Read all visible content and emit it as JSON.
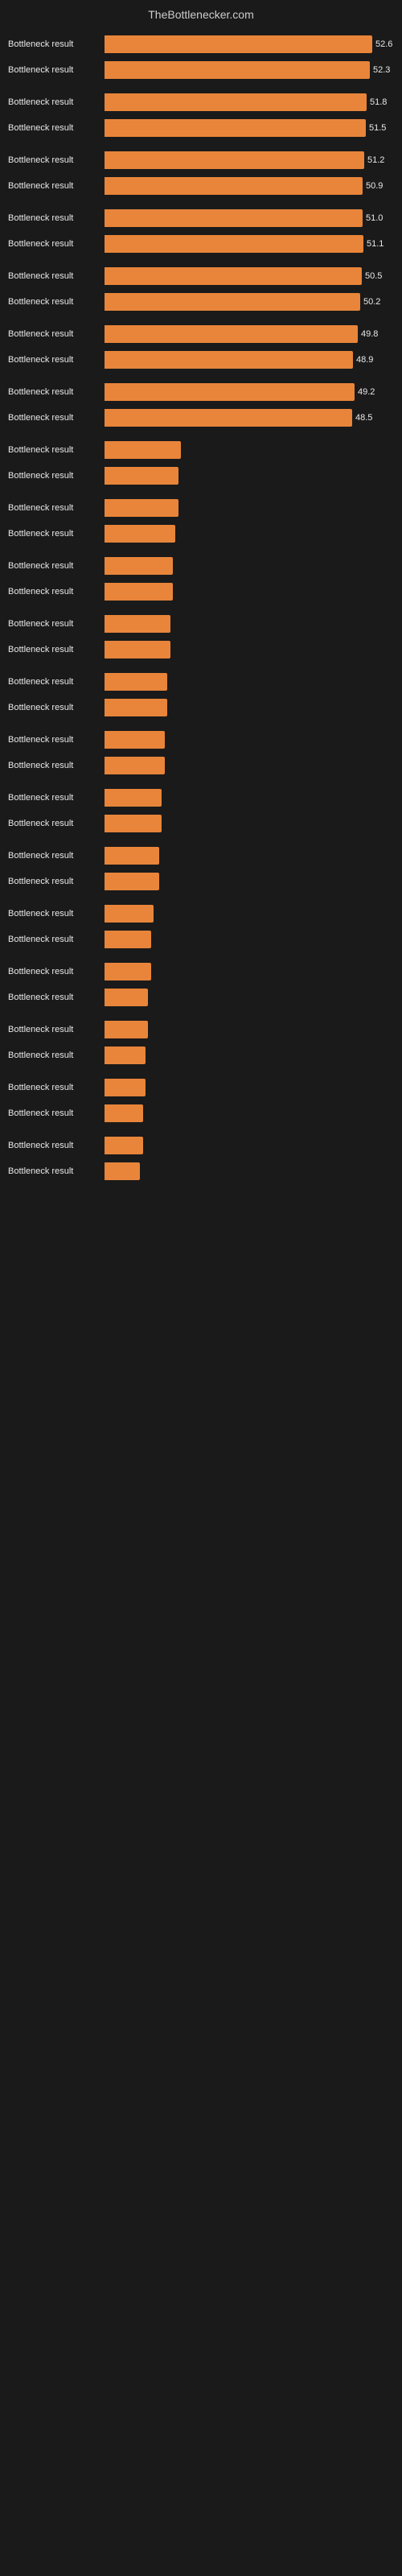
{
  "header": {
    "title": "TheBottlenecker.com"
  },
  "bars": [
    {
      "label": "Bottleneck result",
      "value": 52.6,
      "display": "52.6",
      "width_pct": 98
    },
    {
      "label": "Bottleneck result",
      "value": 52.3,
      "display": "52.3",
      "width_pct": 97
    },
    {
      "label": "Bottleneck result",
      "value": 51.8,
      "display": "51.8",
      "width_pct": 96
    },
    {
      "label": "Bottleneck result",
      "value": 51.5,
      "display": "51.5",
      "width_pct": 95.5
    },
    {
      "label": "Bottleneck result",
      "value": 51.2,
      "display": "51.2",
      "width_pct": 95
    },
    {
      "label": "Bottleneck result",
      "value": 50.9,
      "display": "50.9",
      "width_pct": 94.5
    },
    {
      "label": "Bottleneck result",
      "value": 51.0,
      "display": "51.0",
      "width_pct": 94.5
    },
    {
      "label": "Bottleneck result",
      "value": 51.1,
      "display": "51.1",
      "width_pct": 94.8
    },
    {
      "label": "Bottleneck result",
      "value": 50.5,
      "display": "50.5",
      "width_pct": 94
    },
    {
      "label": "Bottleneck result",
      "value": 50.2,
      "display": "50.2",
      "width_pct": 93.5
    },
    {
      "label": "Bottleneck result",
      "value": 49.8,
      "display": "49.8",
      "width_pct": 92.5
    },
    {
      "label": "Bottleneck result",
      "value": 48.9,
      "display": "48.9",
      "width_pct": 91
    },
    {
      "label": "Bottleneck result",
      "value": 49.2,
      "display": "49.2",
      "width_pct": 91.5
    },
    {
      "label": "Bottleneck result",
      "value": 48.5,
      "display": "48.5",
      "width_pct": 90.5
    },
    {
      "label": "Bottleneck result",
      "value": null,
      "display": "",
      "width_pct": 28
    },
    {
      "label": "Bottleneck result",
      "value": null,
      "display": "",
      "width_pct": 27
    },
    {
      "label": "Bottleneck result",
      "value": null,
      "display": "",
      "width_pct": 27
    },
    {
      "label": "Bottleneck result",
      "value": null,
      "display": "",
      "width_pct": 26
    },
    {
      "label": "Bottleneck result",
      "value": null,
      "display": "",
      "width_pct": 25
    },
    {
      "label": "Bottleneck result",
      "value": null,
      "display": "",
      "width_pct": 25
    },
    {
      "label": "Bottleneck result",
      "value": null,
      "display": "",
      "width_pct": 24
    },
    {
      "label": "Bottleneck result",
      "value": null,
      "display": "",
      "width_pct": 24
    },
    {
      "label": "Bottleneck result",
      "value": null,
      "display": "",
      "width_pct": 23
    },
    {
      "label": "Bottleneck result",
      "value": null,
      "display": "",
      "width_pct": 23
    },
    {
      "label": "Bottleneck result",
      "value": null,
      "display": "",
      "width_pct": 22
    },
    {
      "label": "Bottleneck result",
      "value": null,
      "display": "",
      "width_pct": 22
    },
    {
      "label": "Bottleneck result",
      "value": null,
      "display": "",
      "width_pct": 21
    },
    {
      "label": "Bottleneck result",
      "value": null,
      "display": "",
      "width_pct": 21
    },
    {
      "label": "Bottleneck result",
      "value": null,
      "display": "",
      "width_pct": 20
    },
    {
      "label": "Bottleneck result",
      "value": null,
      "display": "",
      "width_pct": 20
    },
    {
      "label": "Bottleneck result",
      "value": null,
      "display": "",
      "width_pct": 18
    },
    {
      "label": "Bottleneck result",
      "value": null,
      "display": "",
      "width_pct": 17
    },
    {
      "label": "Bottleneck result",
      "value": null,
      "display": "",
      "width_pct": 17
    },
    {
      "label": "Bottleneck result",
      "value": null,
      "display": "",
      "width_pct": 16
    },
    {
      "label": "Bottleneck result",
      "value": null,
      "display": "",
      "width_pct": 16
    },
    {
      "label": "Bottleneck result",
      "value": null,
      "display": "",
      "width_pct": 15
    },
    {
      "label": "Bottleneck result",
      "value": null,
      "display": "",
      "width_pct": 15
    },
    {
      "label": "Bottleneck result",
      "value": null,
      "display": "",
      "width_pct": 14
    },
    {
      "label": "Bottleneck result",
      "value": null,
      "display": "",
      "width_pct": 14
    },
    {
      "label": "Bottleneck result",
      "value": null,
      "display": "",
      "width_pct": 13
    }
  ]
}
